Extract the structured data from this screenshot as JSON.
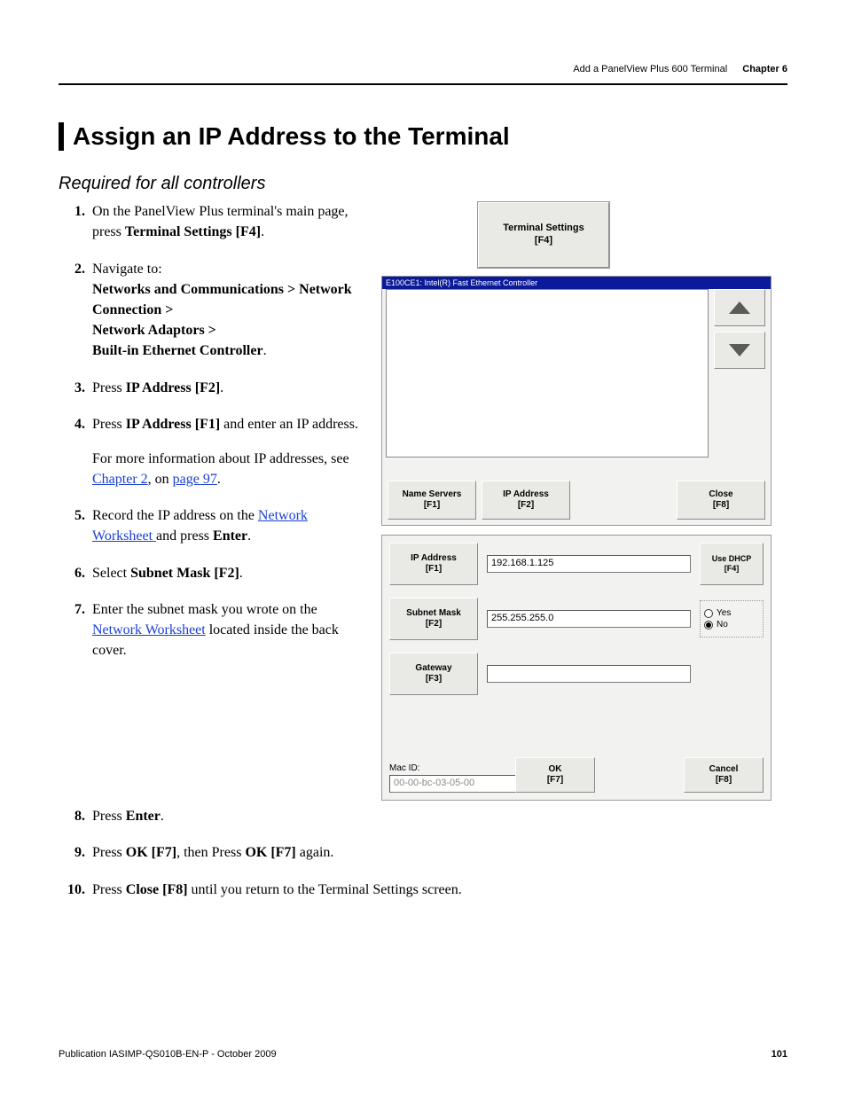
{
  "header": {
    "section": "Add a PanelView Plus 600 Terminal",
    "chapter": "Chapter 6"
  },
  "title": "Assign an IP Address to the Terminal",
  "subtitle": "Required for all controllers",
  "steps": {
    "s1a": "On the PanelView Plus terminal's main page, press ",
    "s1b": "Terminal Settings [F4]",
    "s1c": ".",
    "s2a": "Navigate to:",
    "s2b": "Networks and Communications > Network Connection >",
    "s2c": "Network Adaptors >",
    "s2d": "Built-in Ethernet Controller",
    "s2e": ".",
    "s3a": "Press ",
    "s3b": "IP Address [F2]",
    "s3c": ".",
    "s4a": "Press ",
    "s4b": "IP Address [F1]",
    "s4c": " and enter an IP address.",
    "s4d": "For more information about IP addresses, see ",
    "s4e": "Chapter 2",
    "s4f": ", on ",
    "s4g": "page 97",
    "s4h": ".",
    "s5a": "Record the IP address on the ",
    "s5b": "Network Worksheet ",
    "s5c": "and press ",
    "s5d": "Enter",
    "s5e": ".",
    "s6a": "Select ",
    "s6b": "Subnet Mask [F2]",
    "s6c": ".",
    "s7a": "Enter the subnet mask you wrote on the ",
    "s7b": "Network Worksheet",
    "s7c": " located inside the back cover.",
    "s8a": "Press ",
    "s8b": "Enter",
    "s8c": ".",
    "s9a": "Press ",
    "s9b": "OK [F7]",
    "s9c": ", then Press ",
    "s9d": "OK [F7]",
    "s9e": " again.",
    "s10a": "Press ",
    "s10b": "Close [F8]",
    "s10c": " until you return to the Terminal Settings screen."
  },
  "ui": {
    "ts_btn_label": "Terminal Settings",
    "ts_btn_fkey": "[F4]",
    "list_title": "E100CE1: Intel(R) Fast Ethernet Controller",
    "name_servers": "Name Servers",
    "name_servers_fkey": "[F1]",
    "ip_address": "IP Address",
    "ip_address_fkey": "[F2]",
    "close": "Close",
    "close_fkey": "[F8]",
    "ip_addr_btn": "IP Address",
    "ip_addr_btn_fkey": "[F1]",
    "ip_addr_value": "192.168.1.125",
    "use_dhcp": "Use DHCP",
    "use_dhcp_fkey": "[F4]",
    "subnet_btn": "Subnet Mask",
    "subnet_btn_fkey": "[F2]",
    "subnet_value": "255.255.255.0",
    "yes": "Yes",
    "no": "No",
    "gateway_btn": "Gateway",
    "gateway_btn_fkey": "[F3]",
    "gateway_value": "",
    "mac_label": "Mac ID:",
    "mac_value": "00-00-bc-03-05-00",
    "ok": "OK",
    "ok_fkey": "[F7]",
    "cancel": "Cancel",
    "cancel_fkey": "[F8]"
  },
  "footer": {
    "pub": "Publication IASIMP-QS010B-EN-P - October 2009",
    "page": "101"
  }
}
